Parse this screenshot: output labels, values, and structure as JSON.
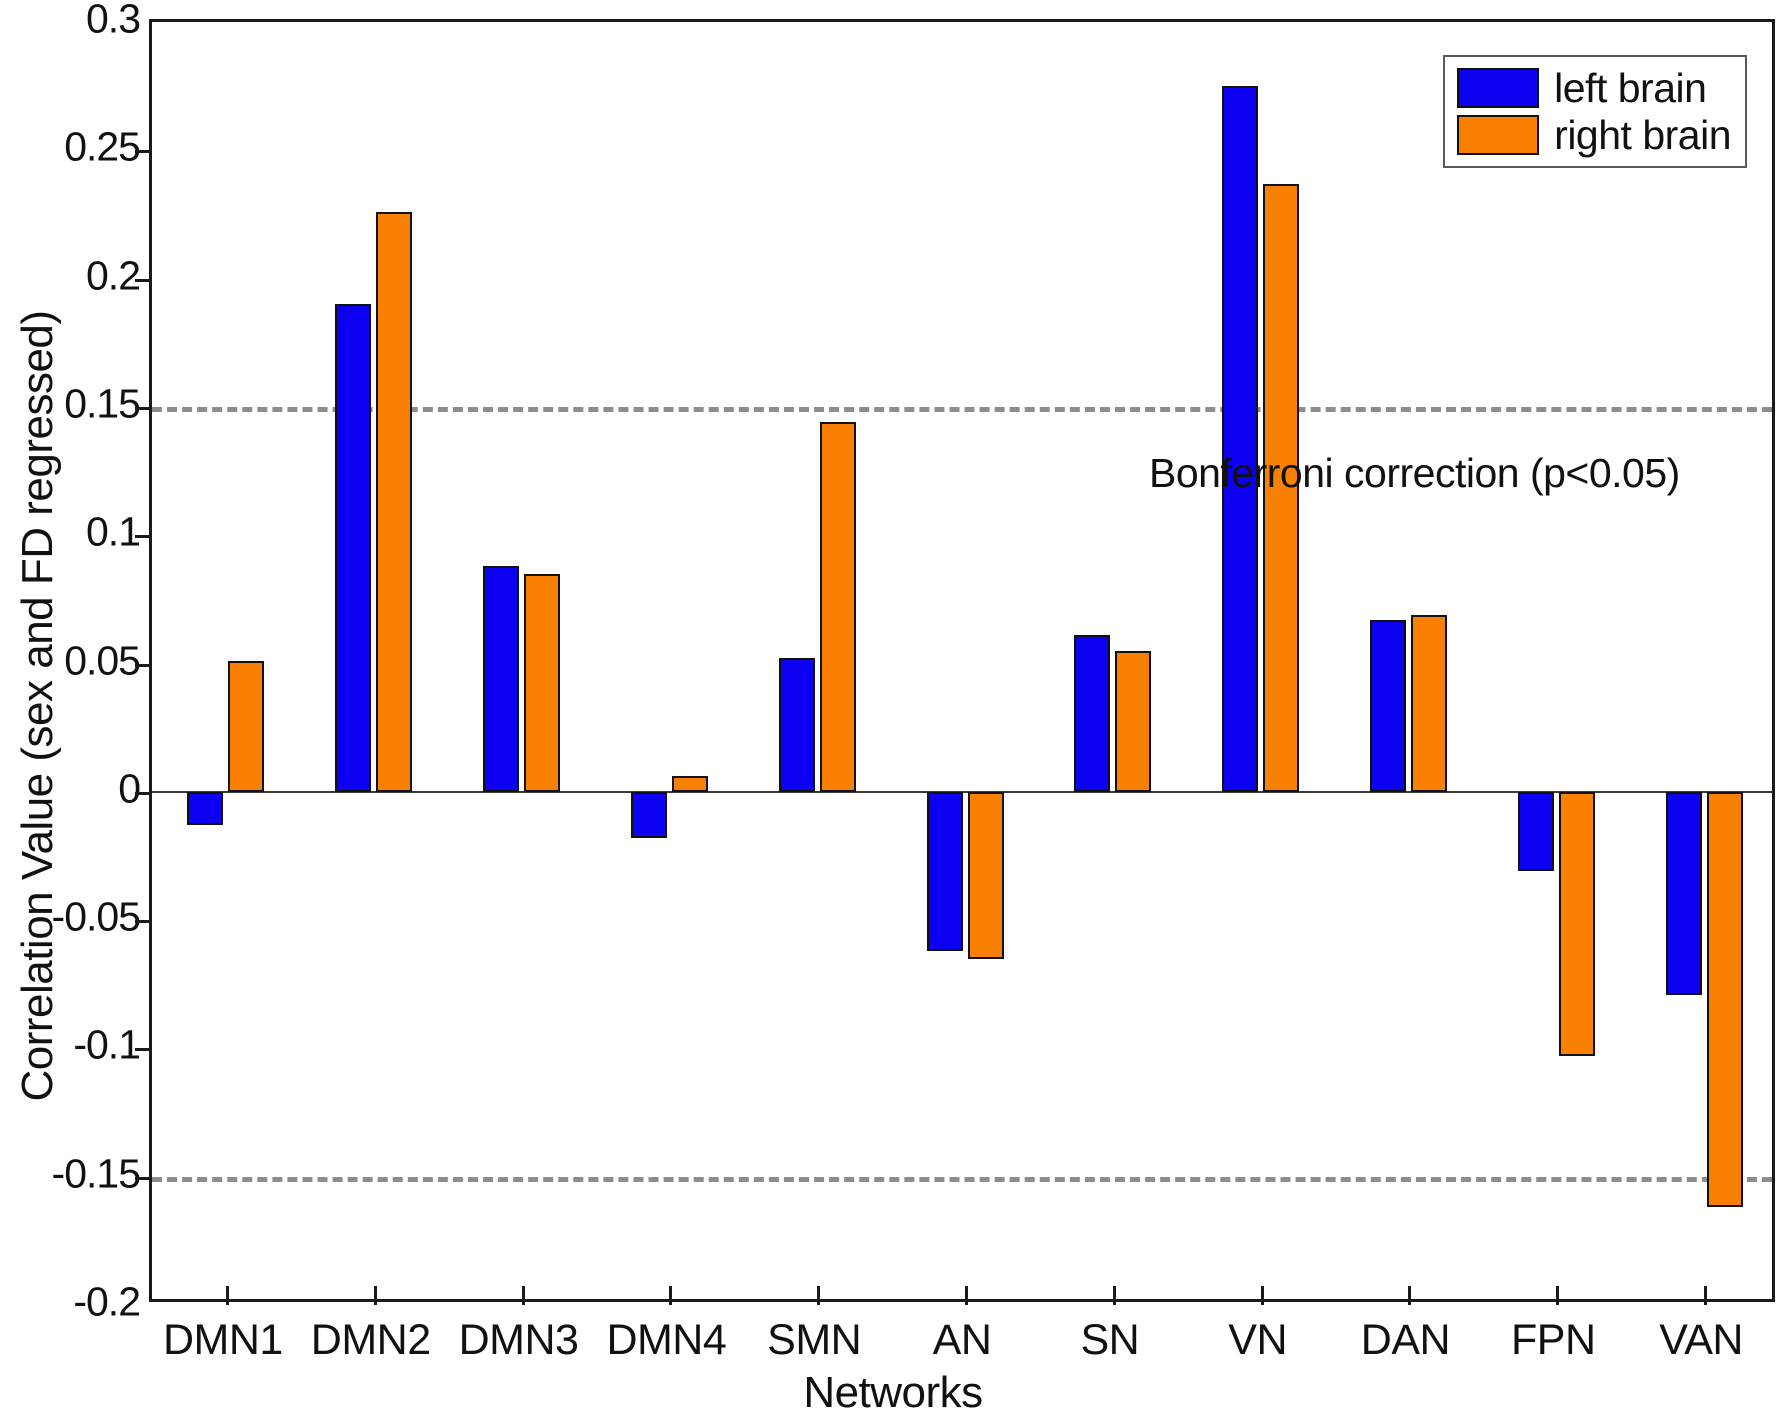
{
  "chart_data": {
    "type": "bar",
    "title": "",
    "xlabel": "Networks",
    "ylabel": "Correlation Value (sex and FD regressed)",
    "categories": [
      "DMN1",
      "DMN2",
      "DMN3",
      "DMN4",
      "SMN",
      "AN",
      "SN",
      "VN",
      "DAN",
      "FPN",
      "VAN"
    ],
    "series": [
      {
        "name": "left brain",
        "color": "#0c00f0",
        "values": [
          -0.013,
          0.19,
          0.088,
          -0.018,
          0.052,
          -0.062,
          0.061,
          0.275,
          0.067,
          -0.031,
          -0.079
        ]
      },
      {
        "name": "right brain",
        "color": "#fa8002",
        "values": [
          0.051,
          0.226,
          0.085,
          0.006,
          0.144,
          -0.065,
          0.055,
          0.237,
          0.069,
          -0.103,
          -0.162
        ]
      }
    ],
    "ylim": [
      -0.2,
      0.3
    ],
    "yticks": [
      0.3,
      0.25,
      0.2,
      0.15,
      0.1,
      0.05,
      0,
      -0.05,
      -0.1,
      -0.15,
      -0.2
    ],
    "ytick_labels": [
      "0.3",
      "0.25",
      "0.2",
      "0.15",
      "0.1",
      "0.05",
      "0",
      "-0.05",
      "-0.1",
      "-0.15",
      "-0.2"
    ],
    "grid": false,
    "legend_position": "top-right",
    "reference_lines": [
      {
        "value": 0.15,
        "style": "dashed",
        "color": "#8d8d8d",
        "label": "Bonferroni correction (p<0.05)"
      },
      {
        "value": -0.15,
        "style": "dashed",
        "color": "#8d8d8d",
        "label": ""
      }
    ],
    "annotations": [
      {
        "text": "Bonferroni correction (p<0.05)",
        "x_frac": 0.615,
        "value": 0.132
      }
    ]
  },
  "legend": {
    "items": [
      {
        "label": "left brain",
        "color": "#0c00f0"
      },
      {
        "label": "right brain",
        "color": "#fa8002"
      }
    ]
  },
  "axes": {
    "y_title": "Correlation Value (sex and FD regressed)",
    "x_title": "Networks"
  }
}
